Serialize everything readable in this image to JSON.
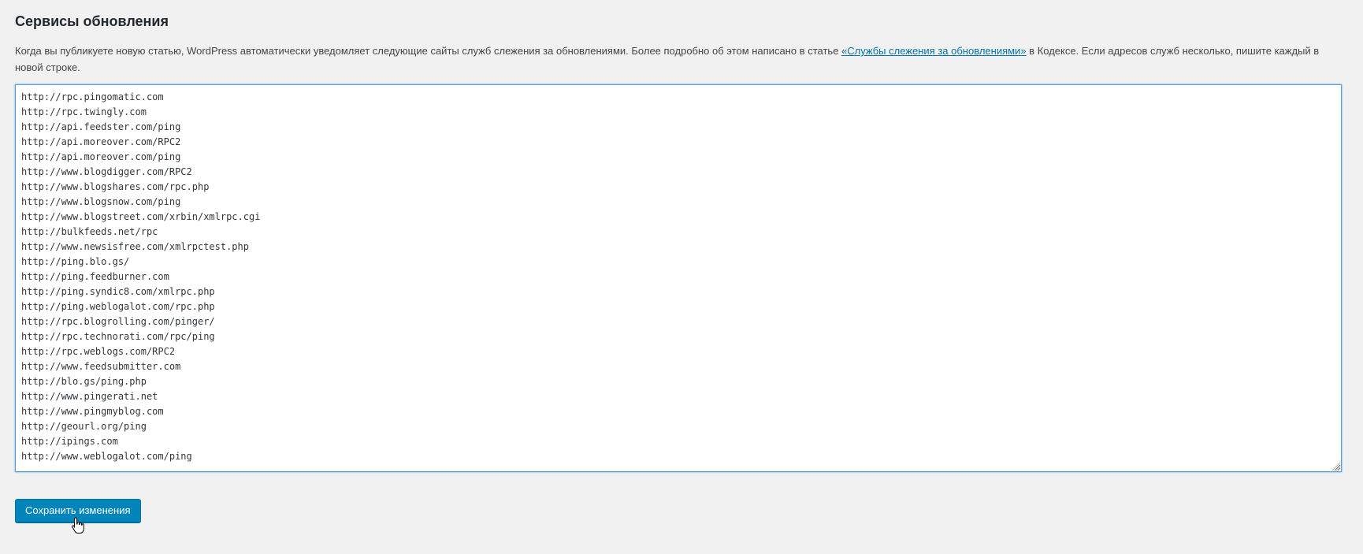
{
  "section": {
    "title": "Сервисы обновления"
  },
  "description": {
    "before_link": "Когда вы публикуете новую статью, WordPress автоматически уведомляет следующие сайты служб слежения за обновлениями. Более подробно об этом написано в статье ",
    "link_text": "«Службы слежения за обновлениями»",
    "after_link": " в Кодексе. Если адресов служб несколько, пишите каждый в новой строке."
  },
  "ping_sites": {
    "value": "http://rpc.pingomatic.com\nhttp://rpc.twingly.com\nhttp://api.feedster.com/ping\nhttp://api.moreover.com/RPC2\nhttp://api.moreover.com/ping\nhttp://www.blogdigger.com/RPC2\nhttp://www.blogshares.com/rpc.php\nhttp://www.blogsnow.com/ping\nhttp://www.blogstreet.com/xrbin/xmlrpc.cgi\nhttp://bulkfeeds.net/rpc\nhttp://www.newsisfree.com/xmlrpctest.php\nhttp://ping.blo.gs/\nhttp://ping.feedburner.com\nhttp://ping.syndic8.com/xmlrpc.php\nhttp://ping.weblogalot.com/rpc.php\nhttp://rpc.blogrolling.com/pinger/\nhttp://rpc.technorati.com/rpc/ping\nhttp://rpc.weblogs.com/RPC2\nhttp://www.feedsubmitter.com\nhttp://blo.gs/ping.php\nhttp://www.pingerati.net\nhttp://www.pingmyblog.com\nhttp://geourl.org/ping\nhttp://ipings.com\nhttp://www.weblogalot.com/ping"
  },
  "actions": {
    "save_label": "Сохранить изменения"
  },
  "colors": {
    "background": "#f1f1f1",
    "link": "#0073aa",
    "primary_button": "#0085ba",
    "focus_border": "#5b9dd9"
  },
  "icons": {
    "cursor": "hand-pointer-icon",
    "resize": "resize-grip-icon"
  }
}
